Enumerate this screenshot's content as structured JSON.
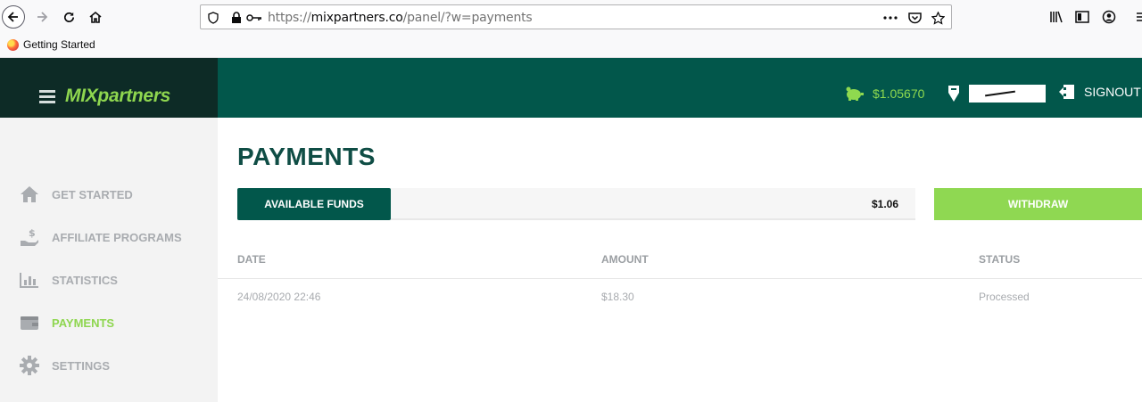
{
  "browser": {
    "url_prefix": "https://",
    "url_host": "mixpartners.co",
    "url_path": "/panel/?w=payments",
    "bookmark": "Getting Started"
  },
  "app": {
    "logo": "MIXpartners",
    "balance": "$1.05670",
    "signout": "SIGNOUT"
  },
  "sidebar": {
    "items": [
      {
        "label": "GET STARTED",
        "icon": "home-icon"
      },
      {
        "label": "AFFILIATE PROGRAMS",
        "icon": "hand-dollar-icon"
      },
      {
        "label": "STATISTICS",
        "icon": "bar-chart-icon"
      },
      {
        "label": "PAYMENTS",
        "icon": "wallet-icon",
        "active": true
      },
      {
        "label": "SETTINGS",
        "icon": "gear-icon"
      }
    ]
  },
  "page": {
    "title": "PAYMENTS",
    "funds_label": "AVAILABLE FUNDS",
    "funds_amount": "$1.06",
    "withdraw": "WITHDRAW"
  },
  "table": {
    "headers": [
      "DATE",
      "AMOUNT",
      "STATUS"
    ],
    "rows": [
      [
        "24/08/2020 22:46",
        "$18.30",
        "Processed"
      ]
    ]
  },
  "colors": {
    "primary": "#02574b",
    "accent": "#8fd852",
    "dark": "#0d2b26"
  }
}
